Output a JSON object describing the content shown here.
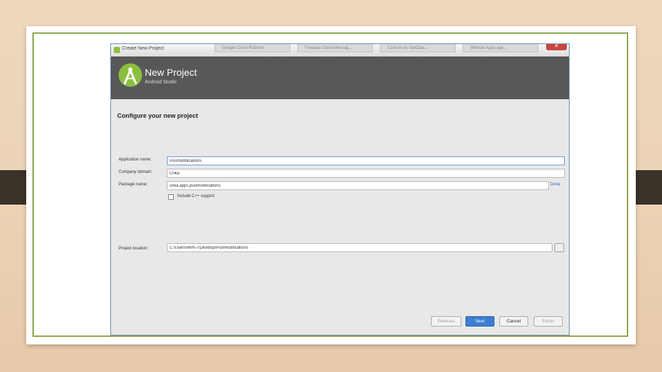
{
  "window": {
    "title": "Create New Project",
    "browser_tabs": [
      "Google Cloud Platform",
      "Firebase Cloud Messag...",
      "Card on no GetData...",
      "Website Apps app..."
    ],
    "close_label": "✕"
  },
  "header": {
    "title": "New Project",
    "subtitle": "Android Studio"
  },
  "form": {
    "section_title": "Configure your new project",
    "app_name_label": "Application name:",
    "app_name_value": "PushNotifications",
    "company_domain_label": "Company domain:",
    "company_domain_value": "Cnka",
    "package_name_label": "Package name:",
    "package_name_value": "cnka.apps.pushnotifications",
    "package_edit_label": "Done",
    "include_cpp_label": "Include C++ support",
    "project_location_label": "Project location:",
    "project_location_value": "C:\\Users\\WIN-7\\Desktop\\PushNotifications",
    "browse_label": "..."
  },
  "footer": {
    "previous_label": "Previous",
    "next_label": "Next",
    "cancel_label": "Cancel",
    "finish_label": "Finish"
  },
  "colors": {
    "accent": "#3d7ed3",
    "android_green": "#8dbf3f",
    "header_bg": "#585858",
    "slide_border": "#8ca64c"
  }
}
